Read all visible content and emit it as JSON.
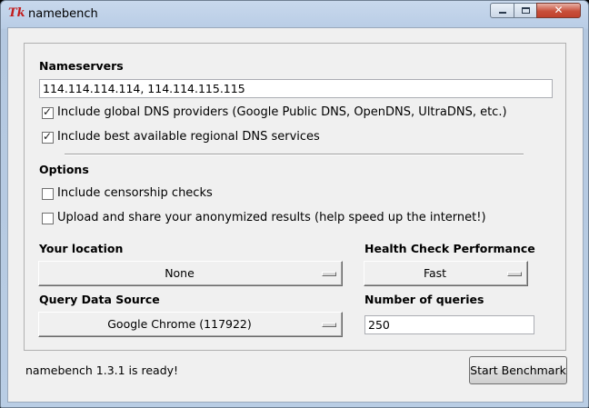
{
  "window": {
    "app_icon_text": "Tk",
    "title": "namebench",
    "controls": {
      "close_glyph": "✕"
    }
  },
  "nameservers": {
    "heading": "Nameservers",
    "value": "114.114.114.114, 114.114.115.115",
    "include_global": {
      "label": "Include global DNS providers (Google Public DNS, OpenDNS, UltraDNS, etc.)",
      "checked": true
    },
    "include_regional": {
      "label": "Include best available regional DNS services",
      "checked": true
    }
  },
  "options": {
    "heading": "Options",
    "censorship": {
      "label": "Include censorship checks",
      "checked": false
    },
    "upload": {
      "label": "Upload and share your anonymized results (help speed up the internet!)",
      "checked": false
    }
  },
  "location": {
    "heading": "Your location",
    "value": "None"
  },
  "health_check": {
    "heading": "Health Check Performance",
    "value": "Fast"
  },
  "query_source": {
    "heading": "Query Data Source",
    "value": "Google Chrome (117922)"
  },
  "num_queries": {
    "heading": "Number of queries",
    "value": "250"
  },
  "status": "namebench 1.3.1 is ready!",
  "start_button": "Start Benchmark",
  "colors": {
    "title_bg": "#b9cde4",
    "client_bg": "#f0f0f0",
    "close_red": "#c8503b"
  }
}
